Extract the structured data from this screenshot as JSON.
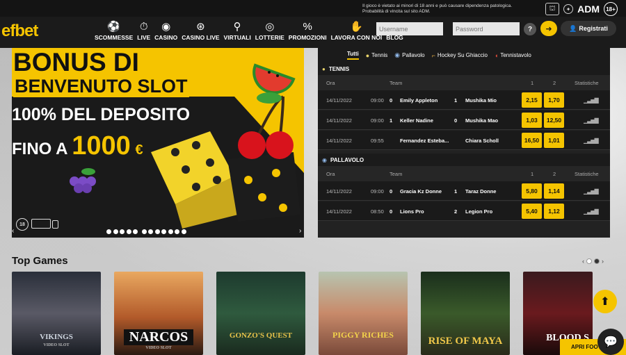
{
  "topbar": {
    "warning_line1": "Il gioco è vietato ai minori di 18 anni e può causare dipendenza patologica.",
    "warning_line2": "Probabilità di vincita sul sito ADM.",
    "adm_label": "ADM",
    "age_badge": "18+"
  },
  "header": {
    "logo": "efbet",
    "nav": [
      {
        "label": "SCOMMESSE",
        "icon": "soccer-ball-icon",
        "glyph": "⚽"
      },
      {
        "label": "LIVE",
        "icon": "stopwatch-icon",
        "glyph": "⏱"
      },
      {
        "label": "CASINO",
        "icon": "casino-chip-icon",
        "glyph": "◉"
      },
      {
        "label": "CASINO LIVE",
        "icon": "roulette-icon",
        "glyph": "⊛"
      },
      {
        "label": "VIRTUALI",
        "icon": "bicycle-icon",
        "glyph": "⚲"
      },
      {
        "label": "LOTTERIE",
        "icon": "lottery-ball-icon",
        "glyph": "◎"
      },
      {
        "label": "PROMOZIONI",
        "icon": "percent-icon",
        "glyph": "%"
      },
      {
        "label": "LAVORA CON NOI",
        "icon": "handshake-icon",
        "glyph": "✋"
      },
      {
        "label": "BLOG",
        "icon": "chat-icon",
        "glyph": "▭"
      }
    ],
    "username_placeholder": "Username",
    "password_placeholder": "Password",
    "help_label": "?",
    "login_icon": "login-arrow-icon",
    "register_label": "Registrati"
  },
  "banner": {
    "line1": "BONUS DI",
    "line2": "BENVENUTO SLOT",
    "line3": "100% DEL DEPOSITO",
    "line4_prefix": "FINO A",
    "amount": "1000",
    "currency": "€",
    "age_badge": "18",
    "slide_count": 12
  },
  "odds": {
    "tabs": [
      {
        "label": "Tutti",
        "icon": "",
        "active": true
      },
      {
        "label": "Tennis",
        "icon": "tennis-ball-icon",
        "active": false
      },
      {
        "label": "Pallavolo",
        "icon": "volleyball-icon",
        "active": false
      },
      {
        "label": "Hockey Su Ghiaccio",
        "icon": "hockey-stick-icon",
        "active": false
      },
      {
        "label": "Tennistavolo",
        "icon": "ping-pong-icon",
        "active": false
      }
    ],
    "columns": {
      "time": "Ora",
      "team": "Team",
      "one": "1",
      "two": "2",
      "stats": "Statistiche"
    },
    "sections": [
      {
        "sport": "TENNIS",
        "icon": "tennis-ball-icon",
        "rows": [
          {
            "date": "14/11/2022",
            "time": "09:00",
            "s1": "0",
            "team1": "Emily Appleton",
            "s2": "1",
            "team2": "Mushika Mio",
            "odd1": "2,15",
            "odd2": "1,70"
          },
          {
            "date": "14/11/2022",
            "time": "09:00",
            "s1": "1",
            "team1": "Keller Nadine",
            "s2": "0",
            "team2": "Mushika Mao",
            "odd1": "1,03",
            "odd2": "12,50"
          },
          {
            "date": "14/11/2022",
            "time": "09:55",
            "s1": "",
            "team1": "Fernandez Esteba...",
            "s2": "",
            "team2": "Chiara Scholl",
            "odd1": "16,50",
            "odd2": "1,01"
          }
        ]
      },
      {
        "sport": "PALLAVOLO",
        "icon": "volleyball-icon",
        "rows": [
          {
            "date": "14/11/2022",
            "time": "09:00",
            "s1": "0",
            "team1": "Gracia Kz Donne",
            "s2": "1",
            "team2": "Taraz Donne",
            "odd1": "5,80",
            "odd2": "1,14"
          },
          {
            "date": "14/11/2022",
            "time": "08:50",
            "s1": "0",
            "team1": "Lions Pro",
            "s2": "2",
            "team2": "Legion Pro",
            "odd1": "5,40",
            "odd2": "1,12"
          }
        ]
      }
    ]
  },
  "top_games": {
    "title": "Top Games",
    "games": [
      {
        "name": "VIKINGS",
        "sub": "VIDEO SLOT"
      },
      {
        "name": "NARCOS",
        "sub": "VIDEO SLOT"
      },
      {
        "name": "GONZO'S QUEST",
        "sub": ""
      },
      {
        "name": "PIGGY RICHES",
        "sub": ""
      },
      {
        "name": "RISE OF MAYA",
        "sub": ""
      },
      {
        "name": "BLOOD S",
        "sub": ""
      }
    ]
  },
  "chat": {
    "label": "APRI FOOT"
  },
  "colors": {
    "accent": "#f5c400",
    "header": "#1b1b1b"
  }
}
